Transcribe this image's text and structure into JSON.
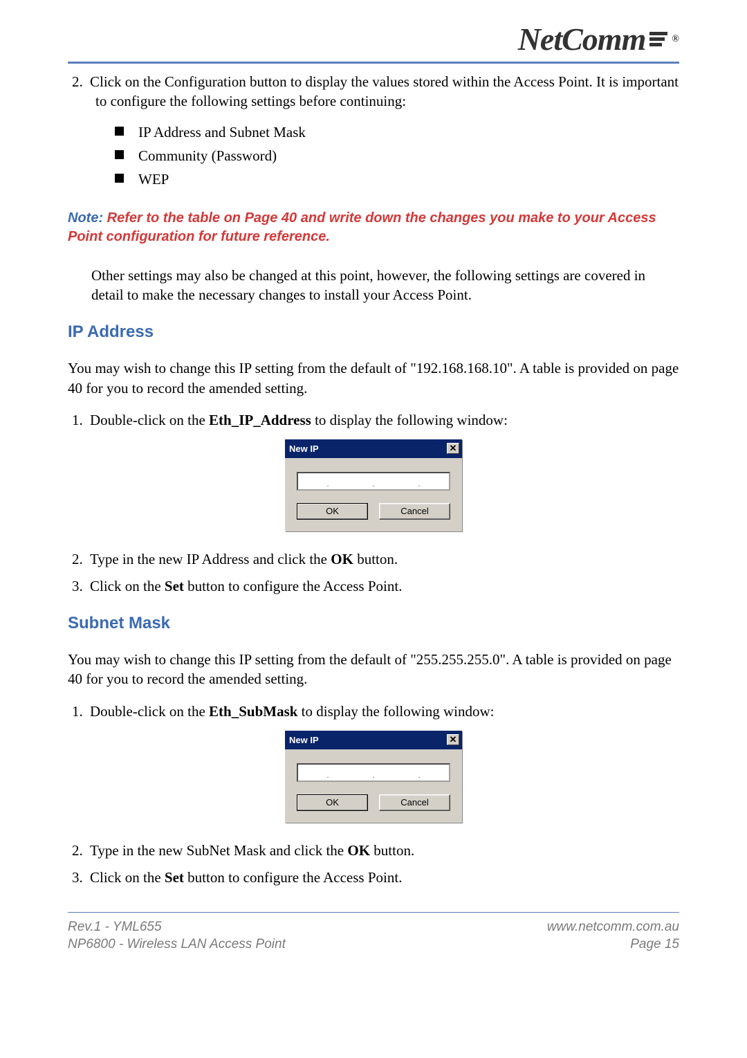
{
  "brand": {
    "name": "NetComm",
    "registered": "®"
  },
  "intro": {
    "num": "2.",
    "text": "Click on the Configuration button to display the values stored within the Access Point. It is important to configure the following settings before continuing:",
    "bullets": [
      "IP Address and Subnet Mask",
      "Community (Password)",
      "WEP"
    ]
  },
  "note": {
    "prefix": "Note:",
    "text": " Refer to the table on Page 40 and write down the changes you make to your Access Point configuration for future reference."
  },
  "otherSettings": "Other settings may also be changed at this point, however, the following settings are covered in detail to make the necessary changes to install your Access Point.",
  "ip": {
    "heading": "IP Address",
    "intro": "You may wish to change this IP setting from the default of \"192.168.168.10\".  A table is provided on page 40 for you to record the amended setting.",
    "steps": [
      {
        "num": "1.",
        "pre": "Double-click on the ",
        "bold": "Eth_IP_Address",
        "post": " to display the following window:"
      },
      {
        "num": "2.",
        "pre": "Type in the new IP Address and click the ",
        "bold": "OK",
        "post": " button."
      },
      {
        "num": "3.",
        "pre": "Click on the ",
        "bold": "Set",
        "post": " button to configure the Access Point."
      }
    ]
  },
  "subnet": {
    "heading": "Subnet Mask",
    "intro": "You may wish to change this IP setting from the default of \"255.255.255.0\".  A table is provided on page 40 for you to record the amended setting.",
    "steps": [
      {
        "num": "1.",
        "pre": "Double-click on the ",
        "bold": "Eth_SubMask",
        "post": " to display the following window:"
      },
      {
        "num": "2.",
        "pre": "Type in the new SubNet Mask and click the ",
        "bold": "OK",
        "post": " button."
      },
      {
        "num": "3.",
        "pre": "Click on the ",
        "bold": "Set",
        "post": " button to configure the Access Point."
      }
    ]
  },
  "dialog": {
    "title": "New IP",
    "close": "✕",
    "dot": ".",
    "ok": "OK",
    "cancel": "Cancel"
  },
  "footer": {
    "leftTop": "Rev.1 - YML655",
    "leftBottom": "NP6800 - Wireless LAN Access Point",
    "rightTop": "www.netcomm.com.au",
    "rightBottom": "Page 15"
  }
}
